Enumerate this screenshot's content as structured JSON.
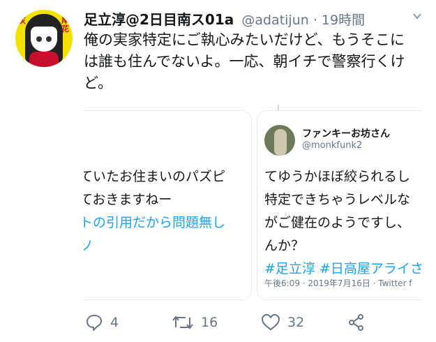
{
  "tweet": {
    "display_name": "足立淳@2日目南ス01a",
    "handle": "@adatijun · 19時間",
    "text": "俺の実家特定にご執心みたいだけど、もうそこには誰も住んでないよ。一応、朝イチで警察行くけど。",
    "avatar_text_left": "灰",
    "avatar_text_right": "岸花"
  },
  "cards": {
    "left": {
      "lines": [
        "ていたお住まいのパズピ",
        "ておきますねー"
      ],
      "link_line": "トの引用だから問題無し",
      "link_fragment": "ソ"
    },
    "right": {
      "name": "ファンキーお坊さん",
      "handle": "@monkfunk2",
      "lines": [
        "てゆうかほぼ絞られるし",
        "特定できちゃうレベルな",
        "がご健在のようですし、",
        "んか？"
      ],
      "hashtags": "#足立淳 #日高屋アライさん",
      "meta": "午後6:09 · 2019年7月16日 · Twitter f"
    }
  },
  "actions": {
    "replies": "4",
    "retweets": "16",
    "likes": "32"
  },
  "colors": {
    "accent": "#1da1f2",
    "muted": "#657786"
  }
}
